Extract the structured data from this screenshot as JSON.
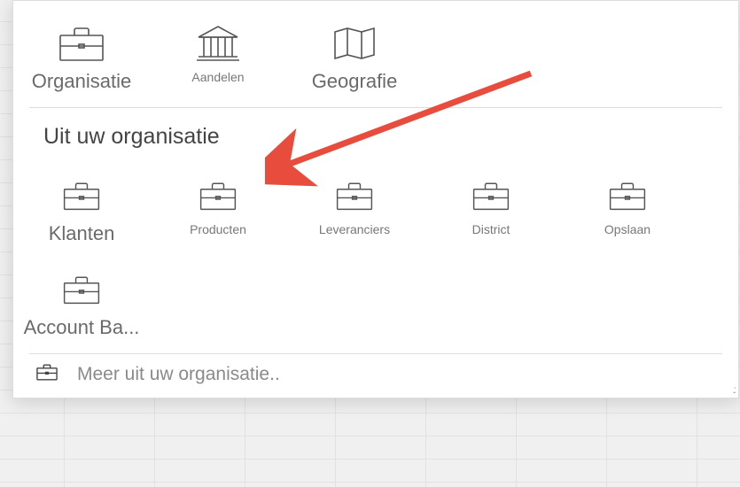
{
  "top_tiles": [
    {
      "label": "Organisatie",
      "icon": "briefcase",
      "primary": true
    },
    {
      "label": "Aandelen",
      "icon": "bank",
      "primary": false
    },
    {
      "label": "Geografie",
      "icon": "map",
      "primary": true
    }
  ],
  "section_header": "Uit uw organisatie",
  "org_tiles": [
    {
      "label": "Klanten",
      "icon": "briefcase",
      "primary": true
    },
    {
      "label": "Producten",
      "icon": "briefcase",
      "primary": false
    },
    {
      "label": "Leveranciers",
      "icon": "briefcase",
      "primary": false
    },
    {
      "label": "District",
      "icon": "briefcase",
      "primary": false
    },
    {
      "label": "Opslaan",
      "icon": "briefcase",
      "primary": false
    },
    {
      "label": "Account Ba...",
      "icon": "briefcase",
      "primary": true
    }
  ],
  "more_label": "Meer uit uw organisatie..",
  "arrow_color": "#e74c3c"
}
